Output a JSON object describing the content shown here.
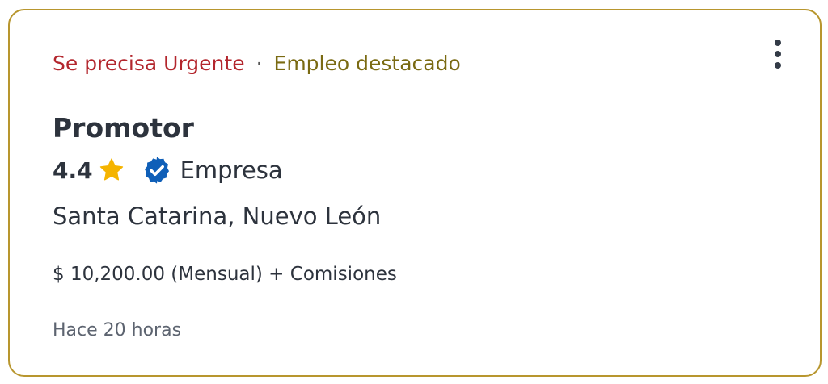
{
  "job": {
    "tag_urgent": "Se precisa Urgente",
    "tag_separator": "·",
    "tag_featured": "Empleo destacado",
    "title": "Promotor",
    "rating": "4.4",
    "company": "Empresa",
    "location": "Santa Catarina, Nuevo León",
    "salary": "$ 10,200.00 (Mensual) + Comisiones",
    "posted": "Hace 20 horas"
  },
  "icons": {
    "rating": "star-icon",
    "verified": "verified-badge-icon",
    "menu": "more-vertical-icon"
  },
  "colors": {
    "border": "#b8962e",
    "urgent": "#b3262d",
    "featured": "#7a6a12",
    "star": "#f5b400",
    "verified": "#0f5fb8",
    "text": "#2d333d",
    "muted": "#5d6470"
  }
}
